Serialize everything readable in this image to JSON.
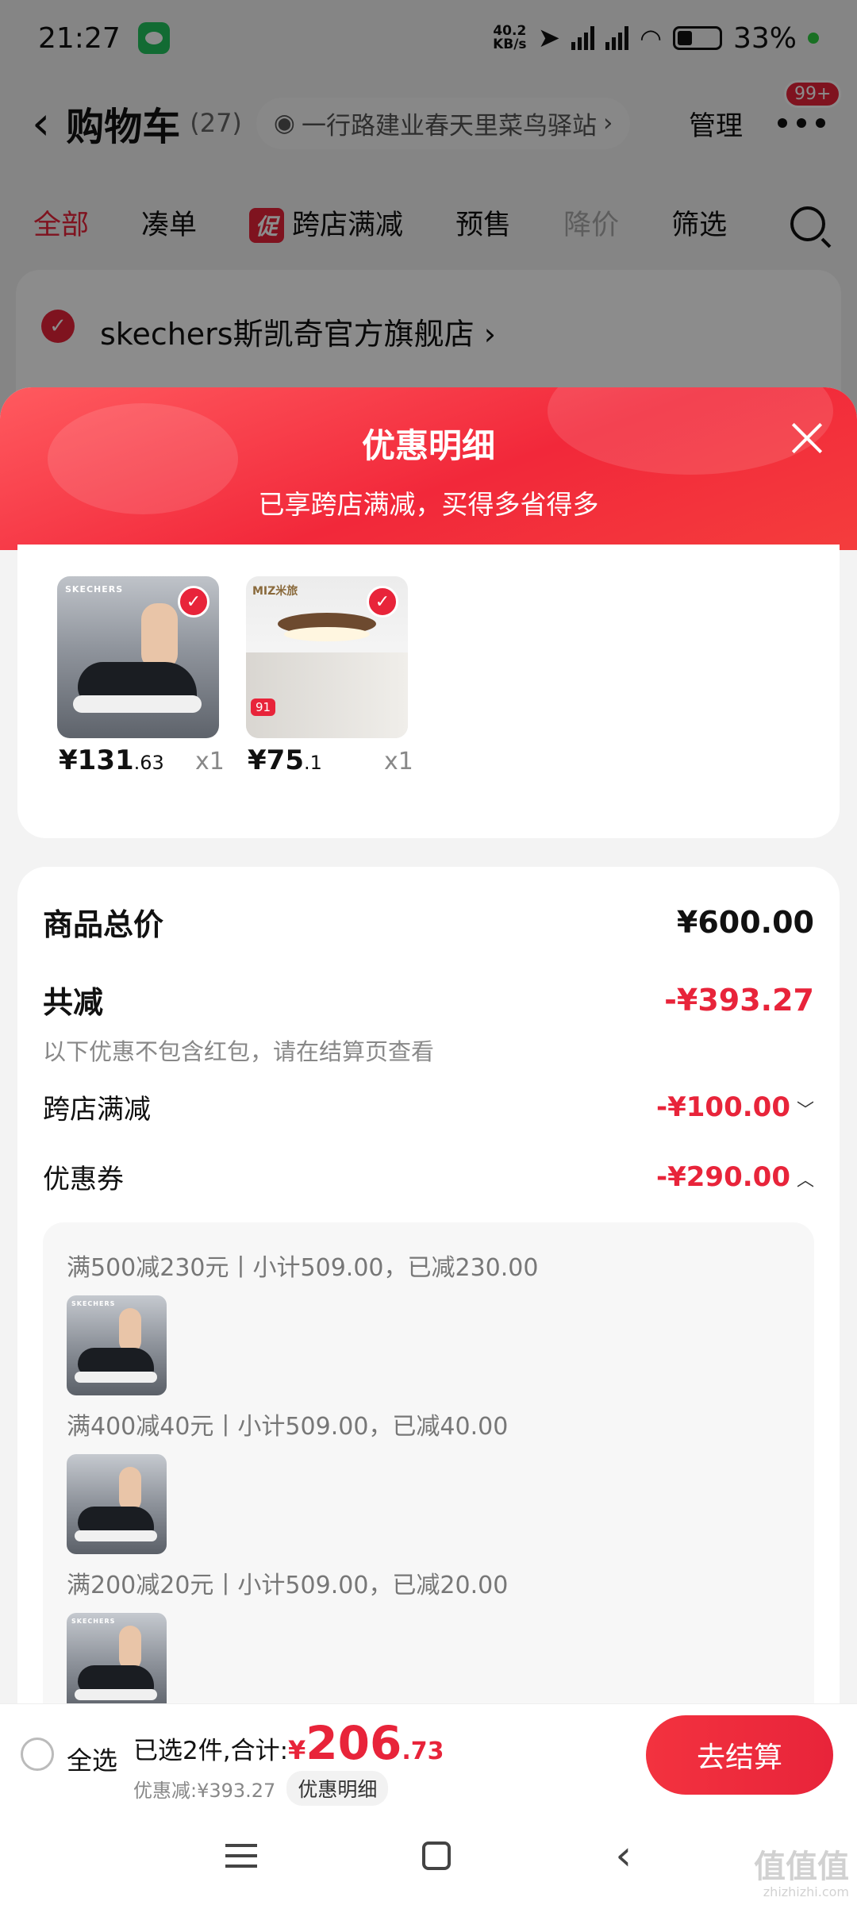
{
  "status_bar": {
    "time": "21:27",
    "net_speed_value": "40.2",
    "net_speed_unit": "KB/s",
    "battery": "33%"
  },
  "header": {
    "back_glyph": "‹",
    "title": "购物车",
    "count": "(27)",
    "location": "一行路建业春天里菜鸟驿站",
    "location_chevron": "›",
    "manage": "管理",
    "badge": "99+"
  },
  "tabs": [
    {
      "label": "全部"
    },
    {
      "label": "凑单"
    },
    {
      "label": "跨店满减",
      "tag": "促"
    },
    {
      "label": "预售"
    },
    {
      "label": "降价"
    },
    {
      "label": "筛选"
    }
  ],
  "store": {
    "name": "skechers斯凯奇官方旗舰店",
    "chevron": "›"
  },
  "sheet": {
    "title": "优惠明细",
    "subtitle": "已享跨店满减，买得多省得多",
    "products": [
      {
        "brand": "SKECHERS",
        "price_int": "¥131",
        "price_dec": ".63",
        "qty": "x1",
        "icon": "shoe-product-image"
      },
      {
        "brand": "MIZ米旅",
        "price_int": "¥75",
        "price_dec": ".1",
        "qty": "x1",
        "icon": "ceiling-lamp-product-image",
        "tag": "91"
      }
    ],
    "summary": {
      "total_label": "商品总价",
      "total_value": "¥600.00",
      "discount_label": "共减",
      "discount_value": "-¥393.27",
      "discount_note": "以下优惠不包含红包，请在结算页查看",
      "cross_store_label": "跨店满减",
      "cross_store_value": "-¥100.00",
      "coupon_label": "优惠券",
      "coupon_value": "-¥290.00",
      "coupons": [
        {
          "text": "满500减230元丨小计509.00，已减230.00"
        },
        {
          "text": "满400减40元丨小计509.00，已减40.00"
        },
        {
          "text": "满200减20元丨小计509.00，已减20.00"
        }
      ]
    }
  },
  "checkout": {
    "select_all": "全选",
    "selected_prefix": "已选2件,合计:",
    "currency": "¥",
    "total_int": "206",
    "total_dec": ".73",
    "discount_text": "优惠减:¥393.27",
    "detail_chip": "优惠明细",
    "button": "去结算"
  },
  "watermark": {
    "main": "值值值",
    "sub": "zhizhizhi.com"
  },
  "colors": {
    "accent": "#e8243a",
    "sheet_header": "#f2283a"
  }
}
